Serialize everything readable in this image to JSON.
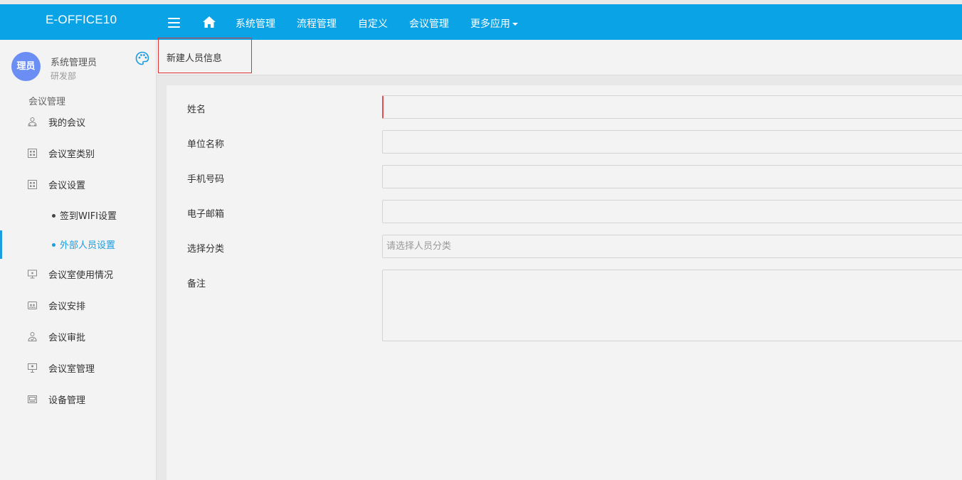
{
  "header": {
    "brand": "E-OFFICE10",
    "nav": [
      "系统管理",
      "流程管理",
      "自定义",
      "会议管理",
      "更多应用"
    ]
  },
  "user": {
    "avatar": "理员",
    "name": "系统管理员",
    "dept": "研发部"
  },
  "sidebar": {
    "section": "会议管理",
    "items": [
      {
        "label": "我的会议",
        "icon": "person-network-icon"
      },
      {
        "label": "会议室类别",
        "icon": "grid-icon"
      },
      {
        "label": "会议设置",
        "icon": "grid-icon"
      },
      {
        "label": "会议室使用情况",
        "icon": "monitor-icon"
      },
      {
        "label": "会议安排",
        "icon": "calendar-people-icon"
      },
      {
        "label": "会议审批",
        "icon": "person-check-icon"
      },
      {
        "label": "会议室管理",
        "icon": "presenter-icon"
      },
      {
        "label": "设备管理",
        "icon": "device-icon"
      }
    ],
    "subitems": [
      "签到WIFI设置",
      "外部人员设置"
    ],
    "active_subitem": "外部人员设置"
  },
  "tab": {
    "label": "新建人员信息"
  },
  "form": {
    "name_label": "姓名",
    "company_label": "单位名称",
    "phone_label": "手机号码",
    "email_label": "电子邮箱",
    "category_label": "选择分类",
    "category_placeholder": "请选择人员分类",
    "remark_label": "备注"
  },
  "colors": {
    "topbar": "#09a3e6",
    "accent": "#1a9ee0",
    "avatar": "#6b8ef5",
    "error": "#e05050"
  }
}
